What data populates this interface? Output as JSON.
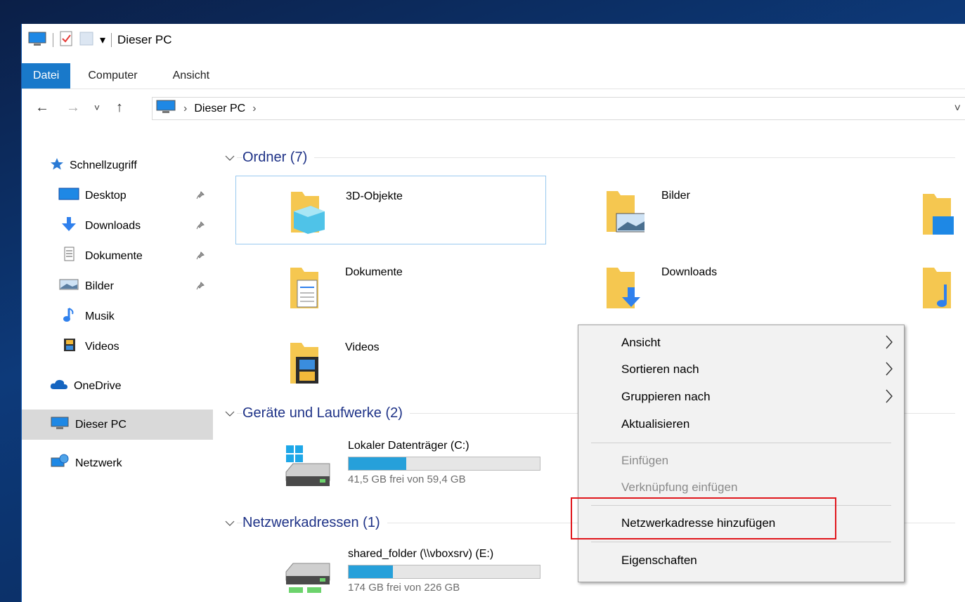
{
  "window": {
    "title": "Dieser PC",
    "qat_dropdown": "▾"
  },
  "ribbon": {
    "tabs": [
      {
        "label": "Datei",
        "active": true
      },
      {
        "label": "Computer",
        "active": false
      },
      {
        "label": "Ansicht",
        "active": false
      }
    ]
  },
  "nav": {
    "back": "←",
    "forward": "→",
    "recent": "˅",
    "up": "↑",
    "breadcrumb_sep": "›",
    "breadcrumb": "Dieser PC",
    "dropdown": "˅"
  },
  "sidebar": {
    "quick_access": "Schnellzugriff",
    "items": [
      {
        "label": "Desktop",
        "icon": "desktop-icon",
        "pinned": true
      },
      {
        "label": "Downloads",
        "icon": "download-arrow-icon",
        "pinned": true
      },
      {
        "label": "Dokumente",
        "icon": "document-icon",
        "pinned": true
      },
      {
        "label": "Bilder",
        "icon": "picture-icon",
        "pinned": true
      },
      {
        "label": "Musik",
        "icon": "music-note-icon",
        "pinned": false
      },
      {
        "label": "Videos",
        "icon": "film-icon",
        "pinned": false
      }
    ],
    "onedrive": "OneDrive",
    "this_pc": "Dieser PC",
    "network": "Netzwerk"
  },
  "content": {
    "folders_header": "Ordner (7)",
    "folders": [
      {
        "name": "3D-Objekte"
      },
      {
        "name": "Bilder"
      },
      {
        "name": "Dokumente"
      },
      {
        "name": "Downloads"
      },
      {
        "name": "Videos"
      }
    ],
    "devices_header": "Geräte und Laufwerke (2)",
    "drive_c": {
      "name": "Lokaler Datenträger (C:)",
      "free": "41,5 GB frei von 59,4 GB",
      "used_fraction": 0.3
    },
    "network_header": "Netzwerkadressen (1)",
    "drive_e": {
      "name": "shared_folder (\\\\vboxsrv) (E:)",
      "free": "174 GB frei von 226 GB",
      "used_fraction": 0.23
    }
  },
  "context_menu": {
    "items": [
      {
        "label": "Ansicht",
        "submenu": true,
        "disabled": false
      },
      {
        "label": "Sortieren nach",
        "submenu": true,
        "disabled": false
      },
      {
        "label": "Gruppieren nach",
        "submenu": true,
        "disabled": false
      },
      {
        "label": "Aktualisieren",
        "submenu": false,
        "disabled": false
      },
      {
        "label": "Einfügen",
        "submenu": false,
        "disabled": true
      },
      {
        "label": "Verknüpfung einfügen",
        "submenu": false,
        "disabled": true
      },
      {
        "label": "Netzwerkadresse hinzufügen",
        "submenu": false,
        "disabled": false
      },
      {
        "label": "Eigenschaften",
        "submenu": false,
        "disabled": false
      }
    ],
    "submenu_arrow": "›"
  },
  "colors": {
    "accent": "#1979ca",
    "section_header": "#1e3287",
    "drive_bar_fill": "#26a0da",
    "annotation": "#e0161c"
  }
}
